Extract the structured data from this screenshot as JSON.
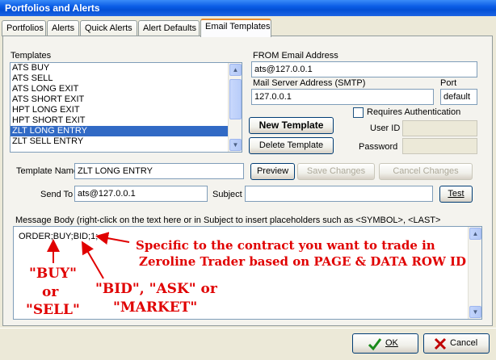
{
  "window": {
    "title": "Portfolios and Alerts"
  },
  "tabs": [
    {
      "label": "Portfolios"
    },
    {
      "label": "Alerts"
    },
    {
      "label": "Quick Alerts"
    },
    {
      "label": "Alert Defaults"
    },
    {
      "label": "Email Templates"
    }
  ],
  "templates": {
    "label": "Templates",
    "items": [
      "ATS BUY",
      "ATS SELL",
      "ATS LONG EXIT",
      "ATS SHORT EXIT",
      "HPT LONG EXIT",
      "HPT SHORT EXIT",
      "ZLT LONG ENTRY",
      "ZLT SELL ENTRY"
    ],
    "selected": "ZLT LONG ENTRY"
  },
  "from_email": {
    "label": "FROM Email Address",
    "value": "ats@127.0.0.1"
  },
  "mail_server": {
    "label": "Mail Server Address (SMTP)",
    "value": "127.0.0.1"
  },
  "port": {
    "label": "Port",
    "value": "default"
  },
  "requires_auth": {
    "label": "Requires Authentication",
    "checked": false
  },
  "user_id": {
    "label": "User ID",
    "value": ""
  },
  "password": {
    "label": "Password",
    "value": ""
  },
  "buttons": {
    "new_template": "New Template",
    "delete_template": "Delete Template",
    "preview": "Preview",
    "save_changes": "Save Changes",
    "cancel_changes": "Cancel Changes",
    "test": "Test",
    "ok": "OK",
    "cancel": "Cancel"
  },
  "template_name": {
    "label": "Template Name",
    "value": "ZLT LONG ENTRY"
  },
  "send_to": {
    "label": "Send To",
    "value": "ats@127.0.0.1"
  },
  "subject": {
    "label": "Subject",
    "value": ""
  },
  "message_body": {
    "label": "Message Body (right-click on the text here or in Subject to insert placeholders such as <SYMBOL>, <LAST>",
    "value": "ORDER;BUY;BID;1;"
  },
  "annotations": {
    "specific_line1": "Specific to the contract you want to trade in",
    "specific_line2": "Zeroline Trader based on PAGE & DATA ROW ID",
    "buy": "\"BUY\"",
    "or": "or",
    "sell": "\"SELL\"",
    "bid_ask": "\"BID\", \"ASK\" or",
    "market": "\"MARKET\""
  },
  "colors": {
    "title_blue": "#0a5ce6",
    "selection": "#316ac5",
    "annotation_red": "#e00000",
    "ok_check": "#1a8a1a",
    "cancel_x": "#c00000"
  },
  "icons": {
    "ok": "check-icon",
    "cancel": "x-icon"
  }
}
